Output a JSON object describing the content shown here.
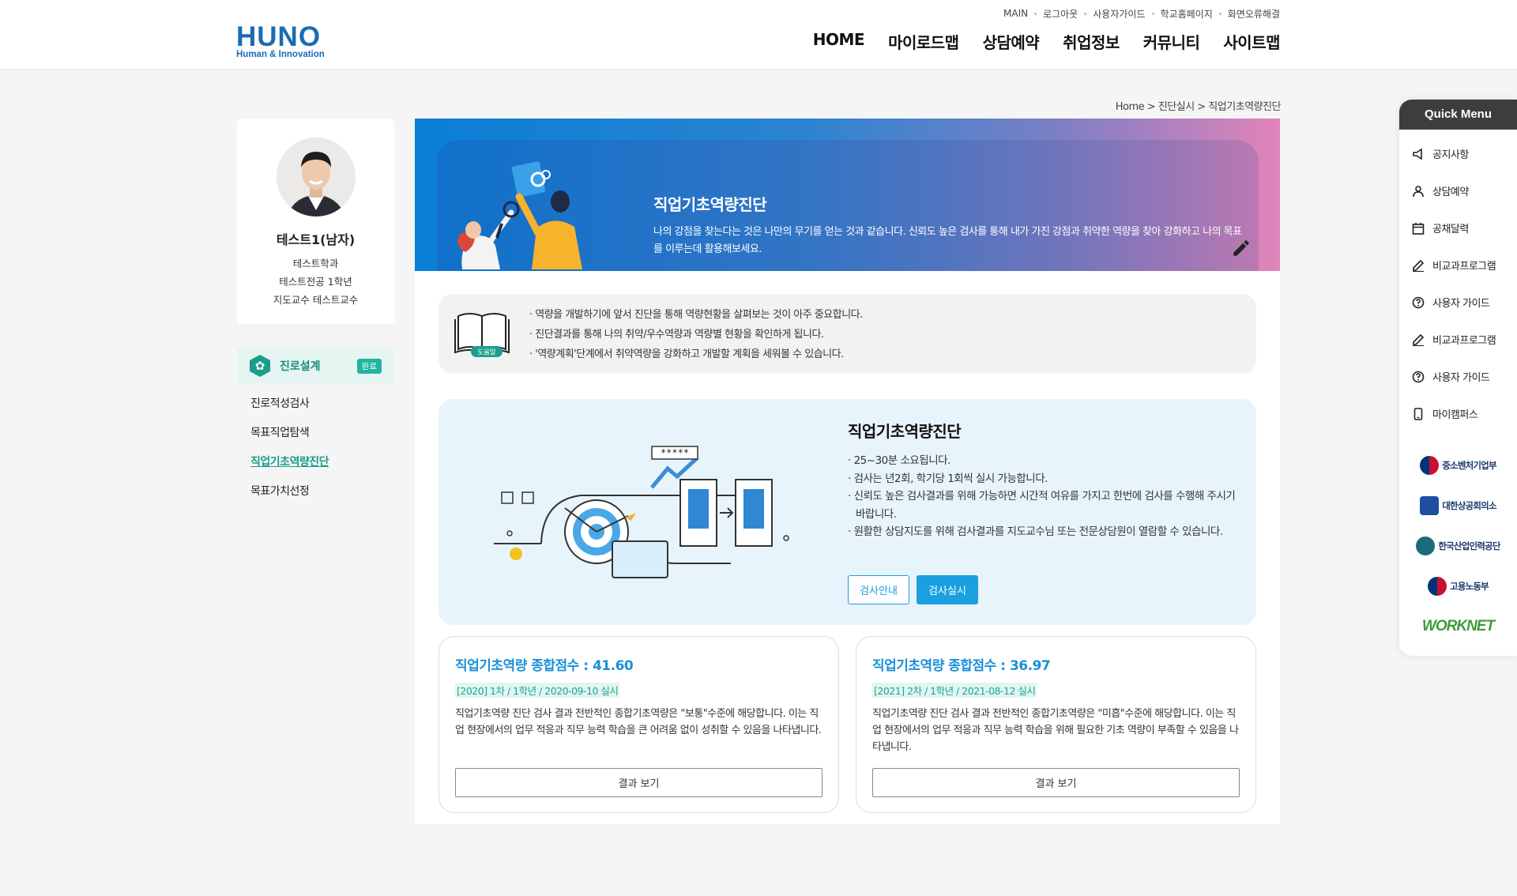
{
  "brand": {
    "logo": "HUNO",
    "tagline": "Human & Innovation"
  },
  "util_links": [
    "MAIN",
    "로그아웃",
    "사용자가이드",
    "학교홈페이지",
    "화면오류해결"
  ],
  "gnb": [
    "HOME",
    "마이로드맵",
    "상담예약",
    "취업정보",
    "커뮤니티",
    "사이트맵"
  ],
  "breadcrumb": "Home > 진단실시 > 직업기초역량진단",
  "profile": {
    "name": "테스트1(남자)",
    "dept": "테스트학과",
    "major": "테스트전공 1학년",
    "advisor": "지도교수 테스트교수"
  },
  "lnb": {
    "title": "진로설계",
    "badge": "완료",
    "items": [
      "진로적성검사",
      "목표직업탐색",
      "직업기초역량진단",
      "목표가치선정"
    ],
    "active_index": 2
  },
  "banner": {
    "title": "직업기초역량진단",
    "desc": "나의 강점을 찾는다는 것은 나만의 무기를 얻는 것과 같습니다. 신뢰도 높은 검사를 통해 내가 가진 강점과 취약한 역량을 찾아 강화하고 나의 목표를 이루는데 활용해보세요."
  },
  "help": {
    "label": "도움말",
    "items": [
      "· 역량을 개발하기에 앞서 진단을 통해 역량현황을 살펴보는 것이 아주 중요합니다.",
      "· 진단결과를 통해 나의 취약/우수역량과 역량별 현황을 확인하게 됩니다.",
      "· '역량계획'단계에서 취약역량을 강화하고 개발할 계획을 세워볼 수 있습니다."
    ]
  },
  "intro": {
    "title": "직업기초역량진단",
    "items": [
      "· 25~30분 소요됩니다.",
      "· 검사는 년2회, 학기당 1회씩 실시 가능합니다.",
      "· 신뢰도 높은 검사결과를 위해 가능하면 시간적 여유를 가지고 한번에 검사를 수행해 주시기 바랍니다.",
      "· 원활한 상담지도를 위해 검사결과를 지도교수님 또는 전문상담원이 열람할 수 있습니다."
    ],
    "btn_guide": "검사안내",
    "btn_start": "검사실시",
    "illust_stars": "*****"
  },
  "results": [
    {
      "score": "직업기초역량 종합점수 : 41.60",
      "date": "[2020] 1차 / 1학년 / 2020-09-10 실시",
      "desc": "직업기초역량 진단 검사 결과 전반적인 종합기초역량은 \"보통\"수준에 해당합니다. 이는 직업 현장에서의 업무 적응과 직무 능력 학습을 큰 어려움 없이 성취할 수 있음을 나타냅니다.",
      "button": "결과 보기"
    },
    {
      "score": "직업기초역량 종합점수 : 36.97",
      "date": "[2021] 2차 / 1학년 / 2021-08-12 실시",
      "desc": "직업기초역량 진단 검사 결과 전반적인 종합기초역량은 \"미흡\"수준에 해당합니다. 이는 직업 현장에서의 업무 적응과 직무 능력 학습을 위해 필요한 기초 역량이 부족할 수 있음을 나타냅니다.",
      "button": "결과 보기"
    }
  ],
  "quick_menu": {
    "title": "Quick Menu",
    "items": [
      {
        "label": "공지사항",
        "icon": "megaphone-icon"
      },
      {
        "label": "상담예약",
        "icon": "person-icon"
      },
      {
        "label": "공채달력",
        "icon": "calendar-icon"
      },
      {
        "label": "비교과프로그램",
        "icon": "pencil-icon"
      },
      {
        "label": "사용자 가이드",
        "icon": "help-circle-icon"
      },
      {
        "label": "비교과프로그램",
        "icon": "pencil-icon"
      },
      {
        "label": "사용자 가이드",
        "icon": "help-circle-icon"
      },
      {
        "label": "마이캠퍼스",
        "icon": "mobile-icon"
      }
    ],
    "agencies": [
      "중소벤처기업부",
      "대한상공회의소",
      "한국산업인력공단",
      "고용노동부",
      "WORKNET"
    ]
  },
  "colors": {
    "brand": "#1a6cb2",
    "accent": "#1aa0e0",
    "teal": "#1a9e8a",
    "score": "#1a90d8"
  }
}
